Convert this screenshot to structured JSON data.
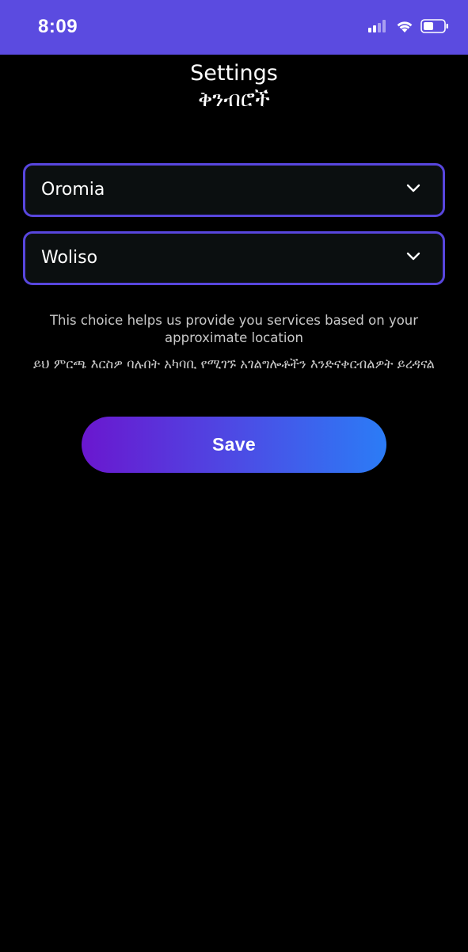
{
  "status_bar": {
    "time": "8:09",
    "background": "#5b4be0",
    "icons": [
      "cellular-signal-icon",
      "wifi-icon",
      "battery-icon"
    ]
  },
  "header": {
    "title_en": "Settings",
    "title_am": "ቅንብሮች"
  },
  "selects": {
    "region": {
      "value": "Oromia",
      "icon": "chevron-down-icon"
    },
    "city": {
      "value": "Woliso",
      "icon": "chevron-down-icon"
    }
  },
  "info": {
    "english": "This choice helps us provide you services based on your approximate location",
    "amharic": "ይህ ምርጫ እርስዎ ባሉበት አካባቢ የሚገኙ አገልግሎቶችን እንድናቀርብልዎት ይረዳናል"
  },
  "save_button": {
    "label": "Save",
    "gradient_start": "#6a17cf",
    "gradient_end": "#2b7cf6"
  },
  "colors": {
    "accent": "#5846de",
    "background": "#000000",
    "field_background": "#0b0f10",
    "muted_text": "#c9c9c9"
  }
}
